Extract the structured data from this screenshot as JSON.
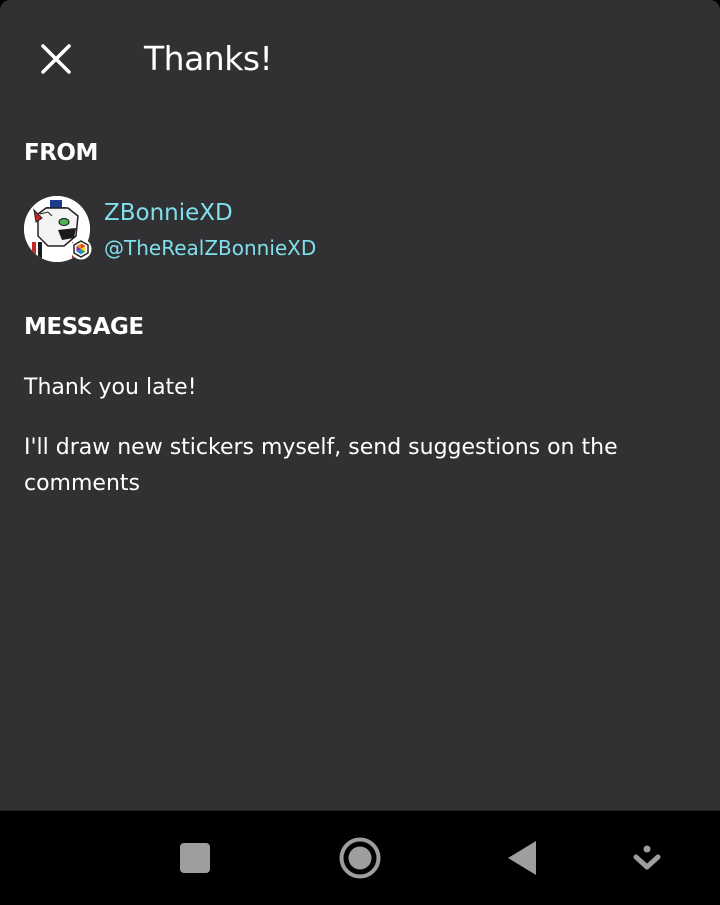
{
  "dialog": {
    "title": "Thanks!",
    "close_icon": "close-icon"
  },
  "from": {
    "label": "FROM",
    "sender_name": "ZBonnieXD",
    "sender_handle": "@TheRealZBonnieXD",
    "avatar": "avatar-image",
    "badge_icon": "hexagon-badge-icon",
    "accent_color": "#7fe0ec"
  },
  "message": {
    "label": "MESSAGE",
    "paragraphs": [
      "Thank you late!",
      "I'll draw new stickers myself, send suggestions on the comments"
    ]
  },
  "navbar": {
    "items": [
      "recents-square-icon",
      "home-circle-icon",
      "back-triangle-icon",
      "notification-pull-icon"
    ]
  },
  "colors": {
    "sheet_background": "#313033",
    "text": "#ffffff",
    "navbar_background": "#000000"
  }
}
